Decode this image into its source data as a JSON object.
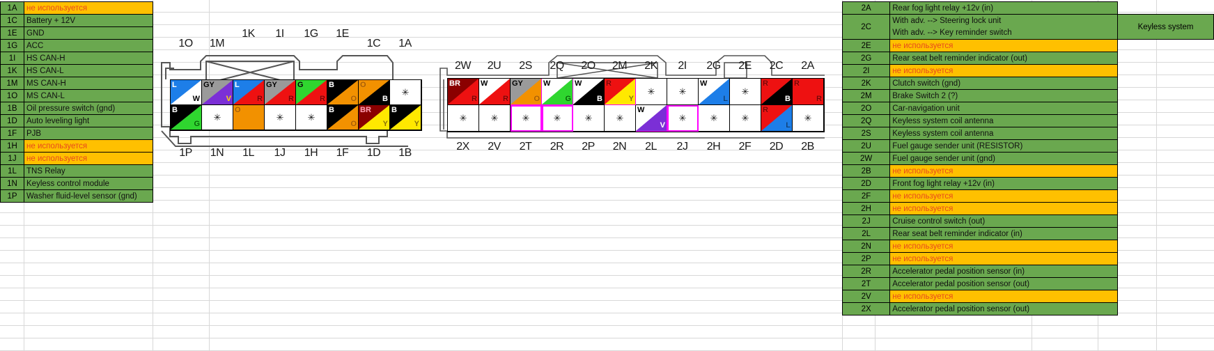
{
  "document": {
    "type": "spreadsheet-wiring-pinout",
    "title": "Connector pinout tables",
    "colors": {
      "green": "#6aa84f",
      "orange_unused": "#ffc000",
      "unused_text": "#e8491d",
      "highlight_outline": "#ff00ff",
      "grid_line": "#d8d8d8"
    },
    "unused_label": "не используется"
  },
  "left_table": {
    "name": "connector-1-pin-table",
    "rows": [
      {
        "pin": "1A",
        "desc": "не используется",
        "unused": true
      },
      {
        "pin": "1C",
        "desc": "Battery + 12V",
        "unused": false
      },
      {
        "pin": "1E",
        "desc": "GND",
        "unused": false
      },
      {
        "pin": "1G",
        "desc": "ACC",
        "unused": false
      },
      {
        "pin": "1I",
        "desc": "HS CAN-H",
        "unused": false
      },
      {
        "pin": "1K",
        "desc": "HS CAN-L",
        "unused": false
      },
      {
        "pin": "1M",
        "desc": "MS CAN-H",
        "unused": false
      },
      {
        "pin": "1O",
        "desc": "MS CAN-L",
        "unused": false
      },
      {
        "pin": "1B",
        "desc": "Oil pressure switch (gnd)",
        "unused": false
      },
      {
        "pin": "1D",
        "desc": "Auto leveling light",
        "unused": false
      },
      {
        "pin": "1F",
        "desc": "PJB",
        "unused": false
      },
      {
        "pin": "1H",
        "desc": "не используется",
        "unused": true
      },
      {
        "pin": "1J",
        "desc": "не используется",
        "unused": true
      },
      {
        "pin": "1L",
        "desc": "TNS Relay",
        "unused": false
      },
      {
        "pin": "1N",
        "desc": "Keyless control module",
        "unused": false
      },
      {
        "pin": "1P",
        "desc": "Washer fluid-level sensor (gnd)",
        "unused": false
      }
    ]
  },
  "right_table": {
    "name": "connector-2-pin-table",
    "note_label": "Keyless system",
    "rows": [
      {
        "pin": "2A",
        "desc": "Rear fog light relay +12v (in)",
        "unused": false
      },
      {
        "pin": "2C",
        "desc": "With adv. --> Steering lock unit",
        "desc2": "With adv. --> Key reminder switch",
        "unused": false,
        "tall": true,
        "note": "Keyless system"
      },
      {
        "pin": "2E",
        "desc": "не используется",
        "unused": true
      },
      {
        "pin": "2G",
        "desc": "Rear seat belt reminder indicator (out)",
        "unused": false
      },
      {
        "pin": "2I",
        "desc": "не используется",
        "unused": true
      },
      {
        "pin": "2K",
        "desc": "Clutch switch (gnd)",
        "unused": false
      },
      {
        "pin": "2M",
        "desc": "Brake Switch 2 (?)",
        "unused": false
      },
      {
        "pin": "2O",
        "desc": "Car-navigation unit",
        "unused": false
      },
      {
        "pin": "2Q",
        "desc": "Keyless system coil antenna",
        "unused": false
      },
      {
        "pin": "2S",
        "desc": "Keyless system coil antenna",
        "unused": false
      },
      {
        "pin": "2U",
        "desc": "Fuel gauge sender unit (RESISTOR)",
        "unused": false
      },
      {
        "pin": "2W",
        "desc": "Fuel gauge sender unit (gnd)",
        "unused": false
      },
      {
        "pin": "2B",
        "desc": "не используется",
        "unused": true
      },
      {
        "pin": "2D",
        "desc": "Front fog light relay +12v (in)",
        "unused": false
      },
      {
        "pin": "2F",
        "desc": "не используется",
        "unused": true
      },
      {
        "pin": "2H",
        "desc": "не используется",
        "unused": true
      },
      {
        "pin": "2J",
        "desc": "Cruise control switch (out)",
        "unused": false
      },
      {
        "pin": "2L",
        "desc": "Rear seat belt reminder indicator (in)",
        "unused": false
      },
      {
        "pin": "2N",
        "desc": "не используется",
        "unused": true
      },
      {
        "pin": "2P",
        "desc": "не используется",
        "unused": true
      },
      {
        "pin": "2R",
        "desc": "Accelerator pedal position sensor (in)",
        "unused": false
      },
      {
        "pin": "2T",
        "desc": "Accelerator pedal position sensor (out)",
        "unused": false
      },
      {
        "pin": "2V",
        "desc": "не используется",
        "unused": true
      },
      {
        "pin": "2X",
        "desc": "Accelerator pedal position sensor (out)",
        "unused": false
      }
    ]
  },
  "connector1": {
    "name": "connector-1-diagram",
    "top_labels": [
      "1O",
      "1M",
      "1K",
      "1I",
      "1G",
      "1E",
      "1C",
      "1A"
    ],
    "bottom_labels": [
      "1P",
      "1N",
      "1L",
      "1J",
      "1H",
      "1F",
      "1D",
      "1B"
    ],
    "top_row": [
      {
        "pin": "1O",
        "a": "L",
        "b": "W",
        "colorA": "#1d7ee8",
        "colorB": "#ffffff",
        "textA": "#ffffff",
        "textB": "#000000"
      },
      {
        "pin": "1M",
        "a": "GY",
        "b": "V",
        "colorA": "#9a9a9a",
        "colorB": "#7b2fd6",
        "textA": "#000000",
        "textB": "#ffd400"
      },
      {
        "pin": "1K",
        "a": "L",
        "b": "R",
        "colorA": "#1d7ee8",
        "colorB": "#ee1111",
        "textA": "#ffffff",
        "textB": "#7a0000"
      },
      {
        "pin": "1I",
        "a": "GY",
        "b": "R",
        "colorA": "#9a9a9a",
        "colorB": "#ee1111",
        "textA": "#000000",
        "textB": "#7a0000"
      },
      {
        "pin": "1G",
        "a": "G",
        "b": "R",
        "colorA": "#2fd62f",
        "colorB": "#ee1111",
        "textA": "#000000",
        "textB": "#7a0000"
      },
      {
        "pin": "1E",
        "a": "B",
        "b": "O",
        "colorA": "#000000",
        "colorB": "#f29100",
        "textA": "#ffffff",
        "textB": "#a85c00"
      },
      {
        "pin": "1C",
        "a": "O",
        "b": "B",
        "colorA": "#f29100",
        "colorB": "#000000",
        "textA": "#a85c00",
        "textB": "#ffffff"
      },
      {
        "pin": "1A",
        "a": "",
        "b": "",
        "star": true
      }
    ],
    "bottom_row": [
      {
        "pin": "1P",
        "a": "B",
        "b": "G",
        "colorA": "#000000",
        "colorB": "#2fd62f",
        "textA": "#ffffff",
        "textB": "#006400"
      },
      {
        "pin": "1N",
        "a": "",
        "b": "",
        "star": true
      },
      {
        "pin": "1L",
        "a": "O",
        "b": "",
        "colorA": "#f29100",
        "colorB": "#f29100",
        "solid": true,
        "textA": "#a85c00"
      },
      {
        "pin": "1J",
        "a": "",
        "b": "",
        "star": true
      },
      {
        "pin": "1H",
        "a": "",
        "b": "",
        "star": true
      },
      {
        "pin": "1F",
        "a": "B",
        "b": "O",
        "colorA": "#000000",
        "colorB": "#f29100",
        "textA": "#ffffff",
        "textB": "#a85c00"
      },
      {
        "pin": "1D",
        "a": "BR",
        "b": "Y",
        "colorA": "#8b0000",
        "colorB": "#ffe800",
        "textA": "#ff9ab0",
        "textB": "#8a7400"
      },
      {
        "pin": "1B",
        "a": "B",
        "b": "Y",
        "colorA": "#000000",
        "colorB": "#ffe800",
        "textA": "#ffffff",
        "textB": "#8a7400"
      }
    ]
  },
  "connector2": {
    "name": "connector-2-diagram",
    "top_labels": [
      "2W",
      "2U",
      "2S",
      "2Q",
      "2O",
      "2M",
      "2K",
      "2I",
      "2G",
      "2E",
      "2C",
      "2A"
    ],
    "bottom_labels": [
      "2X",
      "2V",
      "2T",
      "2R",
      "2P",
      "2N",
      "2L",
      "2J",
      "2H",
      "2F",
      "2D",
      "2B"
    ],
    "top_row": [
      {
        "pin": "2W",
        "a": "BR",
        "b": "R",
        "colorA": "#8b0000",
        "colorB": "#ee1111",
        "textA": "#ffffff",
        "textB": "#7a0000"
      },
      {
        "pin": "2U",
        "a": "W",
        "b": "R",
        "colorA": "#ffffff",
        "colorB": "#ee1111",
        "textA": "#000000",
        "textB": "#7a0000"
      },
      {
        "pin": "2S",
        "a": "GY",
        "b": "O",
        "colorA": "#9a9a9a",
        "colorB": "#f29100",
        "textA": "#000000",
        "textB": "#a85c00",
        "highlight": true
      },
      {
        "pin": "2Q",
        "a": "W",
        "b": "G",
        "colorA": "#ffffff",
        "colorB": "#2fd62f",
        "textA": "#000000",
        "textB": "#006400",
        "highlight": true
      },
      {
        "pin": "2O",
        "a": "W",
        "b": "B",
        "colorA": "#ffffff",
        "colorB": "#000000",
        "textA": "#000000",
        "textB": "#ffffff"
      },
      {
        "pin": "2M",
        "a": "R",
        "b": "Y",
        "colorA": "#ee1111",
        "colorB": "#ffe800",
        "textA": "#7a0000",
        "textB": "#8a7400",
        "highlight": true
      },
      {
        "pin": "2K",
        "a": "",
        "b": "",
        "star": true
      },
      {
        "pin": "2I",
        "a": "",
        "b": "",
        "star": true
      },
      {
        "pin": "2G",
        "a": "W",
        "b": "L",
        "colorA": "#ffffff",
        "colorB": "#1d7ee8",
        "textA": "#000000",
        "textB": "#0a3f7a"
      },
      {
        "pin": "2E",
        "a": "",
        "b": "",
        "star": true
      },
      {
        "pin": "2C",
        "a": "R",
        "b": "B",
        "colorA": "#ee1111",
        "colorB": "#000000",
        "textA": "#7a0000",
        "textB": "#ffffff"
      },
      {
        "pin": "2A",
        "a": "R",
        "b": "",
        "colorA": "#ee1111",
        "colorB": "#ee1111",
        "solid": true,
        "textA": "#7a0000",
        "soloRight": "R"
      }
    ],
    "bottom_row": [
      {
        "pin": "2X",
        "a": "",
        "b": "",
        "star": true
      },
      {
        "pin": "2V",
        "a": "",
        "b": "",
        "star": true
      },
      {
        "pin": "2T",
        "a": "",
        "b": "",
        "star": true,
        "highlight": true
      },
      {
        "pin": "2R",
        "a": "",
        "b": "",
        "star": true,
        "highlight": true
      },
      {
        "pin": "2P",
        "a": "",
        "b": "",
        "star": true
      },
      {
        "pin": "2N",
        "a": "",
        "b": "",
        "star": true
      },
      {
        "pin": "2L",
        "a": "W",
        "b": "V",
        "colorA": "#ffffff",
        "colorB": "#7b2fd6",
        "textA": "#000000",
        "textB": "#ffffff",
        "highlight": true
      },
      {
        "pin": "2J",
        "a": "",
        "b": "",
        "star": true,
        "highlight": true
      },
      {
        "pin": "2H",
        "a": "",
        "b": "",
        "star": true
      },
      {
        "pin": "2F",
        "a": "",
        "b": "",
        "star": true
      },
      {
        "pin": "2D",
        "a": "R",
        "b": "L",
        "colorA": "#ee1111",
        "colorB": "#1d7ee8",
        "textA": "#7a0000",
        "textB": "#0a3f7a"
      },
      {
        "pin": "2B",
        "a": "",
        "b": "",
        "star": true
      }
    ]
  }
}
